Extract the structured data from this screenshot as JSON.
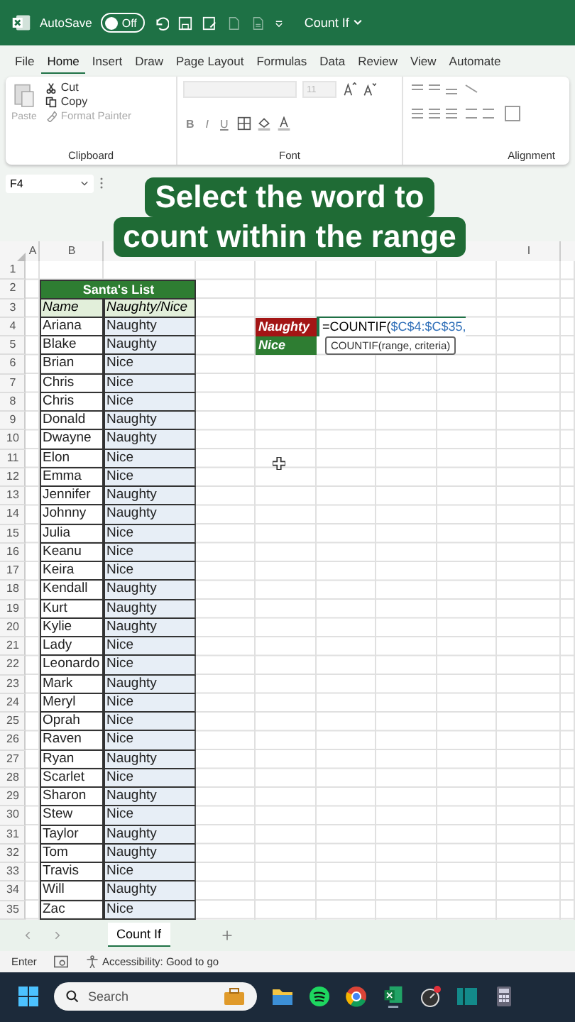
{
  "title_bar": {
    "autosave_label": "AutoSave",
    "autosave": {
      "label": "Off",
      "on": false
    },
    "document_title": "Count If"
  },
  "ribbon_tabs": [
    {
      "label": "File",
      "selected": false
    },
    {
      "label": "Home",
      "selected": true
    },
    {
      "label": "Insert",
      "selected": false
    },
    {
      "label": "Draw",
      "selected": false
    },
    {
      "label": "Page Layout",
      "selected": false
    },
    {
      "label": "Formulas",
      "selected": false
    },
    {
      "label": "Data",
      "selected": false
    },
    {
      "label": "Review",
      "selected": false
    },
    {
      "label": "View",
      "selected": false
    },
    {
      "label": "Automate",
      "selected": false
    }
  ],
  "ribbon": {
    "clipboard": {
      "paste": "Paste",
      "cut": "Cut",
      "copy": "Copy",
      "format_painter": "Format Painter",
      "group_label": "Clipboard"
    },
    "font": {
      "font_size": "11",
      "bold": "B",
      "italic": "I",
      "underline": "U",
      "group_label": "Font"
    },
    "alignment": {
      "group_label": "Alignment"
    }
  },
  "name_box": "F4",
  "caption": [
    "Select the word to",
    "count within the range"
  ],
  "column_headers": [
    "A",
    "B",
    "I"
  ],
  "row_numbers": [
    "1",
    "2",
    "3",
    "4",
    "5",
    "6",
    "7",
    "8",
    "9",
    "10",
    "11",
    "12",
    "13",
    "14",
    "15",
    "16",
    "17",
    "18",
    "19",
    "20",
    "21",
    "22",
    "23",
    "24",
    "25",
    "26",
    "27",
    "28",
    "29",
    "30",
    "31",
    "32",
    "33",
    "34",
    "35"
  ],
  "santas_list": {
    "title": "Santa's List",
    "headers": [
      "Name",
      "Naughty/Nice"
    ],
    "rows": [
      {
        "name": "Ariana",
        "status": "Naughty"
      },
      {
        "name": "Blake",
        "status": "Naughty"
      },
      {
        "name": "Brian",
        "status": "Nice"
      },
      {
        "name": "Chris",
        "status": "Nice"
      },
      {
        "name": "Chris",
        "status": "Nice"
      },
      {
        "name": "Donald",
        "status": "Naughty"
      },
      {
        "name": "Dwayne",
        "status": "Naughty"
      },
      {
        "name": "Elon",
        "status": "Nice"
      },
      {
        "name": "Emma",
        "status": "Nice"
      },
      {
        "name": "Jennifer",
        "status": "Naughty"
      },
      {
        "name": "Johnny",
        "status": "Naughty"
      },
      {
        "name": "Julia",
        "status": "Nice"
      },
      {
        "name": "Keanu",
        "status": "Nice"
      },
      {
        "name": "Keira",
        "status": "Nice"
      },
      {
        "name": "Kendall",
        "status": "Naughty"
      },
      {
        "name": "Kurt",
        "status": "Naughty"
      },
      {
        "name": "Kylie",
        "status": "Naughty"
      },
      {
        "name": "Lady",
        "status": "Nice"
      },
      {
        "name": "Leonardo",
        "status": "Nice"
      },
      {
        "name": "Mark",
        "status": "Naughty"
      },
      {
        "name": "Meryl",
        "status": "Nice"
      },
      {
        "name": "Oprah",
        "status": "Nice"
      },
      {
        "name": "Raven",
        "status": "Nice"
      },
      {
        "name": "Ryan",
        "status": "Naughty"
      },
      {
        "name": "Scarlet",
        "status": "Nice"
      },
      {
        "name": "Sharon",
        "status": "Naughty"
      },
      {
        "name": "Stew",
        "status": "Nice"
      },
      {
        "name": "Taylor",
        "status": "Naughty"
      },
      {
        "name": "Tom",
        "status": "Naughty"
      },
      {
        "name": "Travis",
        "status": "Nice"
      },
      {
        "name": "Will",
        "status": "Naughty"
      },
      {
        "name": "Zac",
        "status": "Nice"
      }
    ]
  },
  "summary": [
    {
      "label": "Naughty",
      "color": "#a31515"
    },
    {
      "label": "Nice",
      "color": "#2e7d32"
    }
  ],
  "active_cell": {
    "function": "=COUNTIF(",
    "range": "$C$4:$C$35,",
    "tooltip": "COUNTIF(range, criteria)"
  },
  "sheet_tabs": [
    {
      "label": "Count If",
      "selected": true
    }
  ],
  "status_bar": {
    "mode": "Enter",
    "accessibility": "Accessibility: Good to go"
  },
  "taskbar": {
    "search_placeholder": "Search"
  }
}
